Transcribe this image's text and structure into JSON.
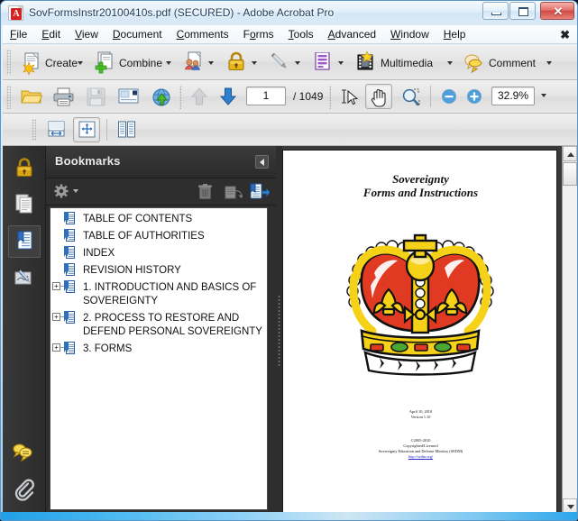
{
  "window": {
    "title": "SovFormsInstr20100410s.pdf (SECURED) - Adobe Acrobat Pro",
    "app_icon": "acrobat-pdf-icon",
    "minimize_label": "",
    "maximize_label": "",
    "close_label": "✕"
  },
  "menubar": {
    "items": [
      {
        "label": "File",
        "accel": "F"
      },
      {
        "label": "Edit",
        "accel": "E"
      },
      {
        "label": "View",
        "accel": "V"
      },
      {
        "label": "Document",
        "accel": "D"
      },
      {
        "label": "Comments",
        "accel": "C"
      },
      {
        "label": "Forms",
        "accel": "o"
      },
      {
        "label": "Tools",
        "accel": "T"
      },
      {
        "label": "Advanced",
        "accel": "A"
      },
      {
        "label": "Window",
        "accel": "W"
      },
      {
        "label": "Help",
        "accel": "H"
      }
    ],
    "close_document_label": "✖"
  },
  "toolbar_tasks": {
    "buttons": [
      {
        "label": "Create",
        "icon": "create-pdf-icon",
        "has_dropdown": true
      },
      {
        "label": "Combine",
        "icon": "combine-files-icon",
        "has_dropdown": true
      },
      {
        "label": "",
        "icon": "collaborate-icon",
        "has_dropdown": true
      },
      {
        "label": "",
        "icon": "secure-lock-icon",
        "has_dropdown": true
      },
      {
        "label": "",
        "icon": "sign-pen-icon",
        "has_dropdown": true
      },
      {
        "label": "",
        "icon": "forms-icon",
        "has_dropdown": true
      },
      {
        "label": "Multimedia",
        "icon": "multimedia-film-icon",
        "has_dropdown": true
      },
      {
        "label": "Comment",
        "icon": "comment-balloon-icon",
        "has_dropdown": true
      }
    ]
  },
  "toolbar_nav": {
    "open_icon": "open-folder-icon",
    "print_icon": "print-icon",
    "save_icon": "save-disk-icon",
    "email_icon": "email-icon",
    "upload_icon": "upload-globe-icon",
    "previous_page_icon": "arrow-up-icon",
    "next_page_icon": "arrow-down-icon",
    "page_number": "1",
    "page_total": "/ 1049",
    "select_tool_icon": "select-text-cursor-icon",
    "hand_tool_icon": "hand-tool-icon",
    "marquee_zoom_icon": "marquee-zoom-icon",
    "zoom_out_icon": "zoom-out-icon",
    "zoom_in_icon": "zoom-in-icon",
    "zoom_value": "32.9%",
    "zoom_dropdown_icon": "chevron-down-icon"
  },
  "toolbar_pagedisplay": {
    "fit_width_icon": "fit-width-icon",
    "fit_page_icon": "fit-page-icon",
    "two_up_icon": "two-page-view-icon",
    "active": "fit-page-icon"
  },
  "navigation_rail": {
    "items": [
      {
        "icon": "security-lock-icon",
        "name": "security-panel",
        "active": false
      },
      {
        "icon": "page-thumbnails-icon",
        "name": "pages-panel",
        "active": false
      },
      {
        "icon": "bookmarks-icon",
        "name": "bookmarks-panel",
        "active": true
      },
      {
        "icon": "signatures-icon",
        "name": "signatures-panel",
        "active": false
      },
      {
        "icon": "comments-icon",
        "name": "comments-panel",
        "active": false
      },
      {
        "icon": "attachments-paperclip-icon",
        "name": "attachments-panel",
        "active": false
      }
    ]
  },
  "bookmarks_panel": {
    "title": "Bookmarks",
    "collapse_icon": "collapse-panel-icon",
    "options_icon": "gear-options-icon",
    "options_dropdown_icon": "chevron-down-icon",
    "delete_icon": "trash-delete-icon",
    "new_bookmark_icon": "new-bookmark-icon",
    "expand_current_icon": "expand-current-bookmark-icon",
    "items": [
      {
        "label": "TABLE OF CONTENTS",
        "expandable": false
      },
      {
        "label": "TABLE OF AUTHORITIES",
        "expandable": false
      },
      {
        "label": "INDEX",
        "expandable": false
      },
      {
        "label": "REVISION HISTORY",
        "expandable": false
      },
      {
        "label": "1. INTRODUCTION AND BASICS OF SOVEREIGNTY",
        "expandable": true
      },
      {
        "label": "2. PROCESS TO RESTORE AND DEFEND PERSONAL SOVEREIGNTY",
        "expandable": true
      },
      {
        "label": "3. FORMS",
        "expandable": true
      }
    ]
  },
  "document_page": {
    "title_line1": "Sovereignty",
    "title_line2": "Forms and Instructions",
    "image": "royal-crown-illustration",
    "date": "April 10, 2010",
    "version": "Version 1.10",
    "copyright": "©2005-2010",
    "license": "Copyrighted/Licensed",
    "publisher": "Sovereignty Education and Defense Ministry (SEDM)",
    "url": "http://sedm.org/"
  },
  "scrollbar": {
    "up_icon": "scroll-up-arrow-icon",
    "down_icon": "scroll-down-arrow-icon"
  },
  "colors": {
    "accent_blue": "#2f6fbe",
    "crown_red": "#e03a22",
    "crown_gold": "#f5d117",
    "title_text": "#1b3a5c",
    "panel_dark": "#2e2e2e"
  }
}
